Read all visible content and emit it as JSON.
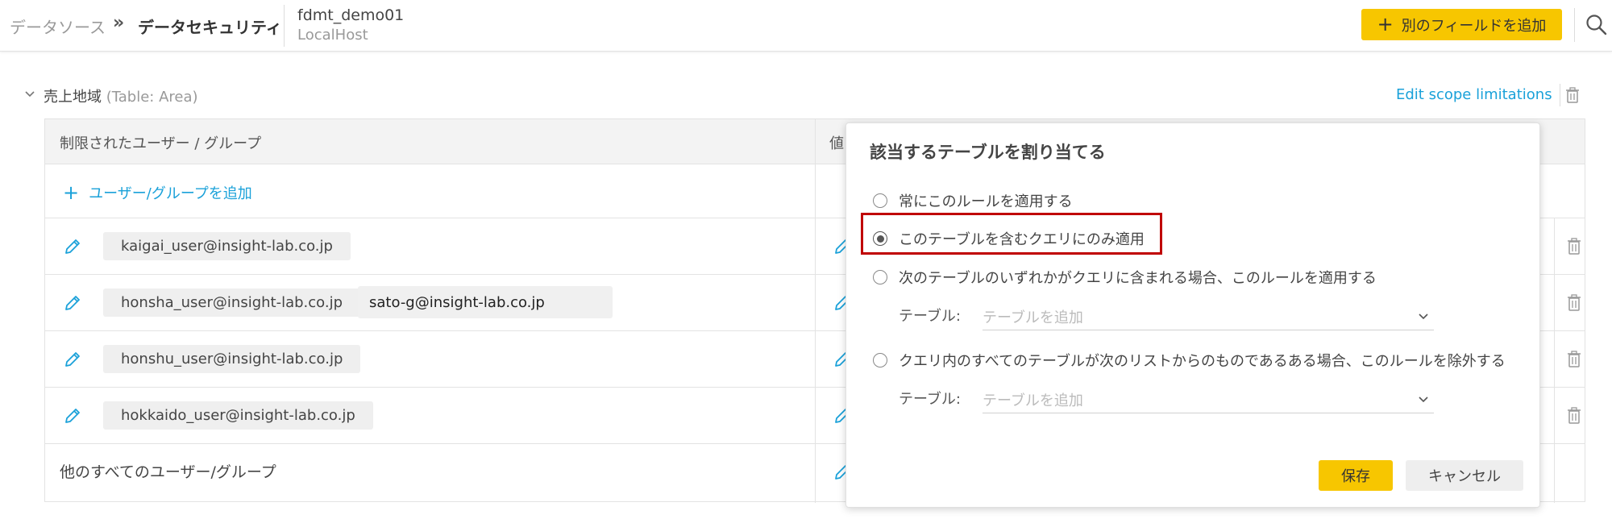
{
  "header": {
    "breadcrumb_parent": "データソース",
    "breadcrumb_separator": "»",
    "breadcrumb_current": "データセキュリティ",
    "datasource_name": "fdmt_demo01",
    "datasource_host": "LocalHost",
    "add_field_label": "別のフィールドを追加"
  },
  "section": {
    "title": "売上地域",
    "subtitle": "(Table: Area)",
    "edit_scope_label": "Edit scope limitations"
  },
  "table": {
    "col_users": "制限されたユーザー / グループ",
    "col_value": "値",
    "add_user_label": "ユーザー/グループを追加",
    "rows": [
      {
        "chips": [
          "kaigai_user@insight-lab.co.jp"
        ]
      },
      {
        "chips": [
          "honsha_user@insight-lab.co.jp"
        ],
        "input_value": "sato-g@insight-lab.co.jp"
      },
      {
        "chips": [
          "honshu_user@insight-lab.co.jp"
        ]
      },
      {
        "chips": [
          "hokkaido_user@insight-lab.co.jp"
        ]
      }
    ],
    "others_label": "他のすべてのユーザー/グループ"
  },
  "popup": {
    "title": "該当するテーブルを割り当てる",
    "options": [
      {
        "label": "常にこのルールを適用する",
        "selected": false
      },
      {
        "label": "このテーブルを含むクエリにのみ適用",
        "selected": true
      },
      {
        "label": "次のテーブルのいずれかがクエリに含まれる場合、このルールを適用する",
        "selected": false
      },
      {
        "label": "クエリ内のすべてのテーブルが次のリストからのものであるある場合、このルールを除外する",
        "selected": false
      }
    ],
    "table_label": "テーブル:",
    "table_placeholder": "テーブルを追加",
    "save_label": "保存",
    "cancel_label": "キャンセル"
  },
  "colors": {
    "accent_yellow": "#f7c600",
    "link_blue": "#1aa1d9",
    "highlight_red": "#c00000"
  }
}
